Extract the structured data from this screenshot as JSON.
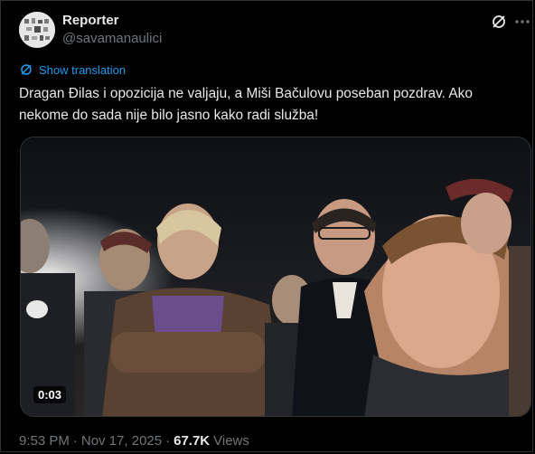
{
  "author": {
    "display_name": "Reporter",
    "handle": "@savamanaulici"
  },
  "icons": {
    "grok": "grok-icon",
    "more": "more-icon",
    "translate": "translate-icon"
  },
  "translate_link": "Show translation",
  "tweet_text": "Dragan Đilas i opozicija ne valjaju, a Miši Bačulovu poseban pozdrav. Ako nekome do sada nije bilo jasno kako radi služba!",
  "media": {
    "duration": "0:03"
  },
  "meta": {
    "time": "9:53 PM",
    "separator1": "·",
    "date": "Nov 17, 2025",
    "separator2": "·",
    "views_count": "67.7K",
    "views_label": "Views"
  },
  "colors": {
    "background": "#000000",
    "text": "#e7e9ea",
    "secondary": "#71767b",
    "accent": "#1d9bf0",
    "border": "#2f3336"
  }
}
